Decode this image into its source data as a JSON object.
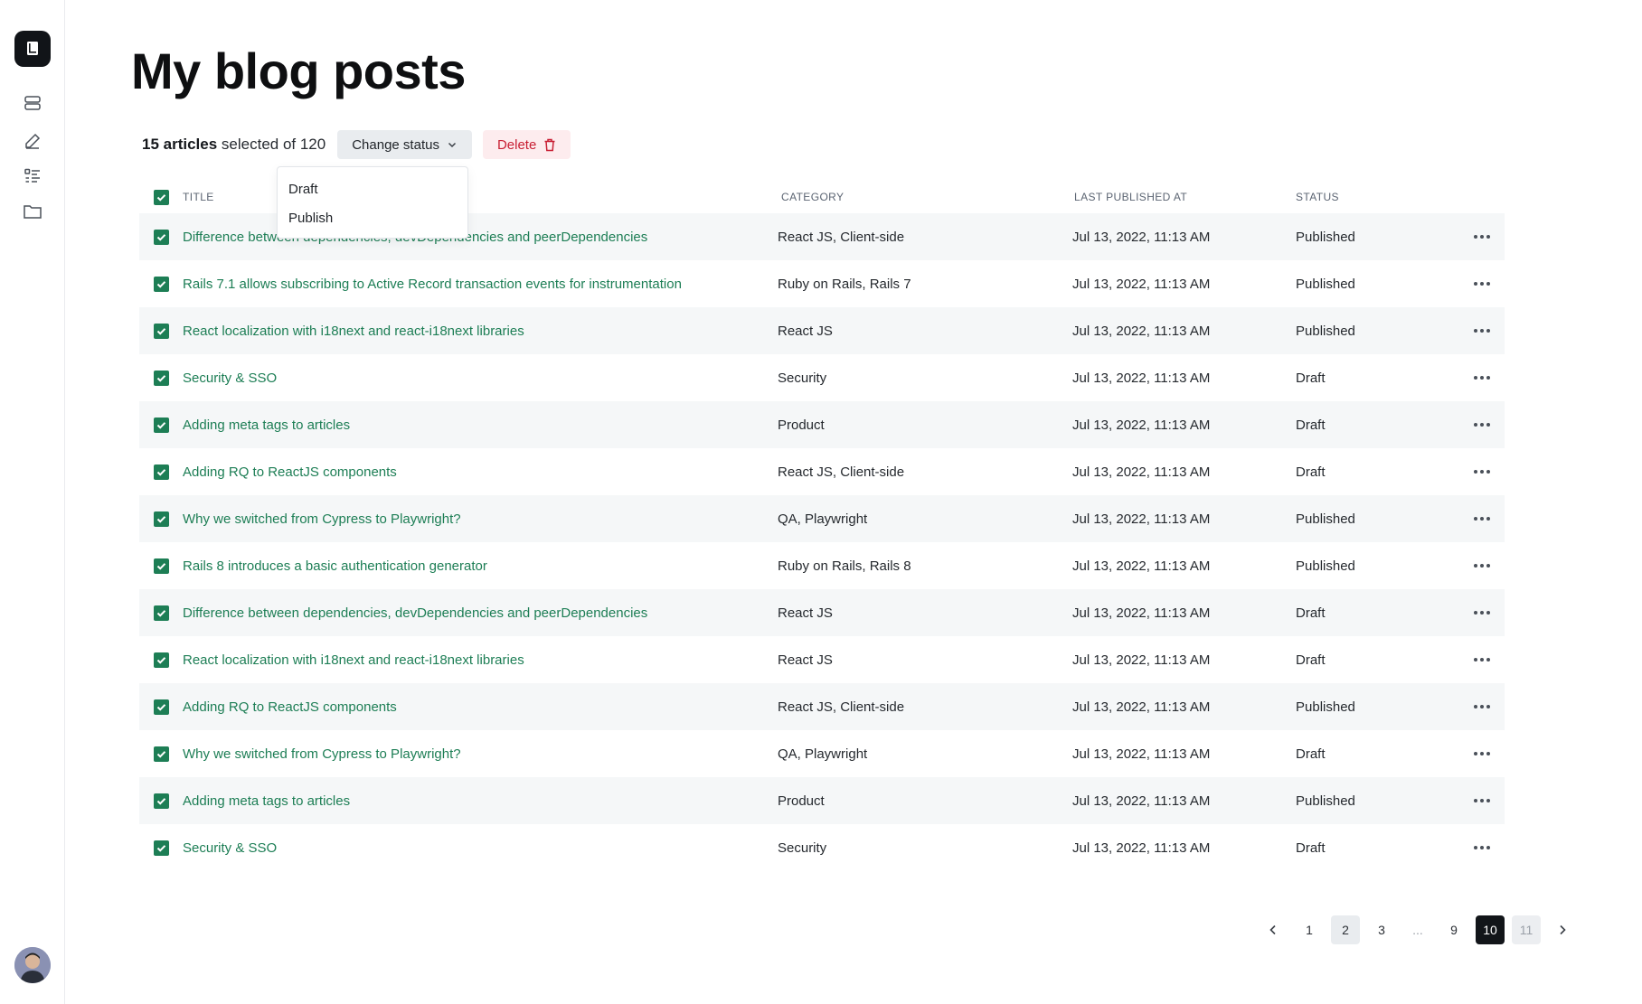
{
  "page": {
    "title": "My blog posts"
  },
  "sidebar": {
    "items": [
      {
        "icon": "layers-icon"
      },
      {
        "icon": "pencil-icon"
      },
      {
        "icon": "list-icon"
      },
      {
        "icon": "folder-icon"
      }
    ]
  },
  "toolbar": {
    "selected_count": "15 articles",
    "selected_suffix": " selected of 120",
    "change_status_label": "Change status",
    "delete_label": "Delete"
  },
  "dropdown": {
    "options": [
      "Draft",
      "Publish"
    ]
  },
  "table": {
    "headers": {
      "title": "Title",
      "category": "Category",
      "last_published": "Last Published At",
      "status": "Status"
    },
    "rows": [
      {
        "title": "Difference between dependencies, devDependencies and peerDependencies",
        "category": "React JS, Client-side",
        "date": "Jul 13, 2022, 11:13 AM",
        "status": "Published"
      },
      {
        "title": "Rails 7.1 allows subscribing to Active Record transaction events for instrumentation",
        "category": "Ruby on Rails,  Rails 7",
        "date": "Jul 13, 2022, 11:13 AM",
        "status": "Published"
      },
      {
        "title": "React localization with i18next and react-i18next libraries",
        "category": "React JS",
        "date": "Jul 13, 2022, 11:13 AM",
        "status": "Published"
      },
      {
        "title": "Security & SSO",
        "category": "Security",
        "date": "Jul 13, 2022, 11:13 AM",
        "status": "Draft"
      },
      {
        "title": "Adding meta tags to articles",
        "category": "Product",
        "date": "Jul 13, 2022, 11:13 AM",
        "status": "Draft"
      },
      {
        "title": "Adding RQ to ReactJS components",
        "category": "React JS, Client-side",
        "date": "Jul 13, 2022, 11:13 AM",
        "status": "Draft"
      },
      {
        "title": "Why we switched from Cypress to Playwright?",
        "category": "QA, Playwright",
        "date": "Jul 13, 2022, 11:13 AM",
        "status": "Published"
      },
      {
        "title": "Rails 8 introduces a basic authentication generator",
        "category": "Ruby on Rails,  Rails 8",
        "date": "Jul 13, 2022, 11:13 AM",
        "status": "Published"
      },
      {
        "title": "Difference between dependencies, devDependencies and peerDependencies",
        "category": "React JS",
        "date": "Jul 13, 2022, 11:13 AM",
        "status": "Draft"
      },
      {
        "title": "React localization with i18next and react-i18next libraries",
        "category": "React JS",
        "date": "Jul 13, 2022, 11:13 AM",
        "status": "Draft"
      },
      {
        "title": "Adding RQ to ReactJS components",
        "category": "React JS, Client-side",
        "date": "Jul 13, 2022, 11:13 AM",
        "status": "Published"
      },
      {
        "title": "Why we switched from Cypress to Playwright?",
        "category": "QA, Playwright",
        "date": "Jul 13, 2022, 11:13 AM",
        "status": "Draft"
      },
      {
        "title": "Adding meta tags to articles",
        "category": "Product",
        "date": "Jul 13, 2022, 11:13 AM",
        "status": "Published"
      },
      {
        "title": "Security & SSO",
        "category": "Security",
        "date": "Jul 13, 2022, 11:13 AM",
        "status": "Draft"
      }
    ]
  },
  "pagination": {
    "pages": [
      {
        "label": "1",
        "state": "default"
      },
      {
        "label": "2",
        "state": "light"
      },
      {
        "label": "3",
        "state": "default"
      },
      {
        "label": "...",
        "state": "dots"
      },
      {
        "label": "9",
        "state": "default"
      },
      {
        "label": "10",
        "state": "current"
      },
      {
        "label": "11",
        "state": "muted"
      }
    ]
  },
  "colors": {
    "accent": "#1d7e55",
    "danger": "#c81e33",
    "dark": "#121519"
  }
}
